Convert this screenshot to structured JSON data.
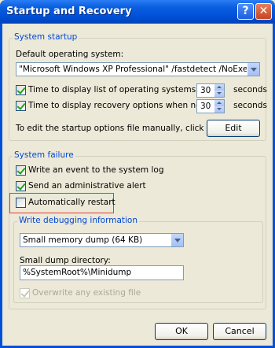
{
  "window": {
    "title": "Startup and Recovery",
    "help_glyph": "?",
    "close_glyph": "✕"
  },
  "system_startup": {
    "legend": "System startup",
    "default_os_label": "Default operating system:",
    "default_os_value": "\"Microsoft Windows XP Professional\" /fastdetect /NoExecute=Op",
    "time_list_label": "Time to display list of operating systems:",
    "time_list_checked": true,
    "time_list_value": "30",
    "time_recovery_label": "Time to display recovery options when needed:",
    "time_recovery_checked": true,
    "time_recovery_value": "30",
    "seconds_label": "seconds",
    "edit_hint": "To edit the startup options file manually, click Edit.",
    "edit_button": "Edit"
  },
  "system_failure": {
    "legend": "System failure",
    "write_event_label": "Write an event to the system log",
    "write_event_checked": true,
    "send_alert_label": "Send an administrative alert",
    "send_alert_checked": true,
    "auto_restart_label": "Automatically restart",
    "auto_restart_checked": false,
    "debug_legend": "Write debugging information",
    "dump_type": "Small memory dump (64 KB)",
    "dump_dir_label": "Small dump directory:",
    "dump_dir_value": "%SystemRoot%\\Minidump",
    "overwrite_label": "Overwrite any existing file",
    "overwrite_checked": true
  },
  "footer": {
    "ok_button": "OK",
    "cancel_button": "Cancel"
  },
  "colors": {
    "legend_blue": "#0046d5",
    "highlight_red": "#e23b36",
    "titlebar_blue": "#0050d8"
  }
}
